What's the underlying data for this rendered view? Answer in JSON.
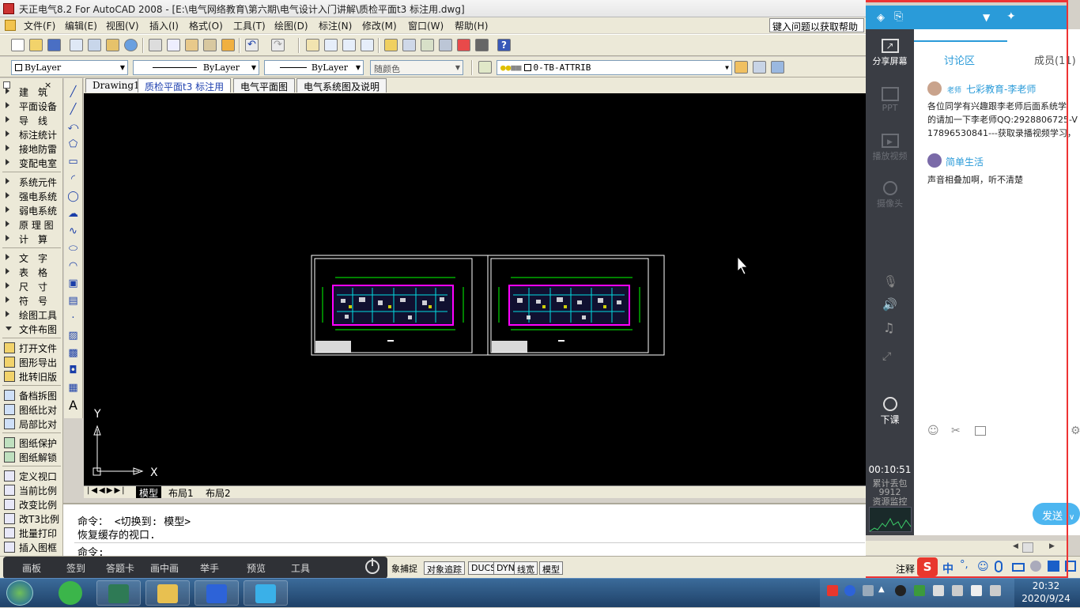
{
  "window": {
    "title": "天正电气8.2 For AutoCAD 2008 - [E:\\电气网络教育\\第六期\\电气设计入门讲解\\质检平面t3 标注用.dwg]"
  },
  "menubar": {
    "items": [
      "文件(F)",
      "编辑(E)",
      "视图(V)",
      "插入(I)",
      "格式(O)",
      "工具(T)",
      "绘图(D)",
      "标注(N)",
      "修改(M)",
      "窗口(W)",
      "帮助(H)"
    ],
    "help_placeholder": "键入问题以获取帮助"
  },
  "properties_bar": {
    "layer_combo": "ByLayer",
    "linetype_combo": "ByLayer",
    "lineweight_combo": "ByLayer",
    "color_combo": "随颜色",
    "current_layer": "0-TB-ATTRIB"
  },
  "left_panel": {
    "group1": [
      "建　筑",
      "平面设备",
      "导　线",
      "标注统计",
      "接地防雷",
      "变配电室"
    ],
    "group2": [
      "系统元件",
      "强电系统",
      "弱电系统",
      "原 理 图",
      "计　算"
    ],
    "group3": [
      "文　字",
      "表　格",
      "尺　寸",
      "符　号",
      "绘图工具",
      "文件布图"
    ],
    "group4": [
      "打开文件",
      "图形导出",
      "批转旧版"
    ],
    "group5": [
      "备档拆图",
      "图纸比对",
      "局部比对"
    ],
    "group6": [
      "图纸保护",
      "图纸解锁"
    ],
    "group7": [
      "定义视口",
      "当前比例",
      "改变比例",
      "改T3比例",
      "批量打印",
      "插入图框"
    ]
  },
  "doc_tabs": {
    "items": [
      "Drawing1",
      "质检平面t3 标注用",
      "电气平面图",
      "电气系统图及说明"
    ],
    "active_index": 1
  },
  "layout_tabs": {
    "items": [
      "模型",
      "布局1",
      "布局2"
    ],
    "active_index": 0
  },
  "canvas": {
    "axis_x": "X",
    "axis_y": "Y"
  },
  "command": {
    "line1": "命令：  <切换到: 模型>",
    "line2": "恢复缓存的视口.",
    "prompt": "命令:"
  },
  "status_bar": {
    "toggles": [
      "象捕捉",
      "对象追踪",
      "DUCS",
      "DYN",
      "线宽",
      "模型"
    ],
    "annotation_label": "注释"
  },
  "overlay_toolbar": {
    "items": [
      "画板",
      "签到",
      "答题卡",
      "画中画",
      "举手",
      "预览",
      "工具"
    ]
  },
  "side_panel": {
    "tabs": {
      "discussion": "讨论区",
      "members": "成员(11)"
    },
    "tools": [
      "分享屏幕",
      "PPT",
      "播放视频",
      "摄像头"
    ],
    "end_class": "下课",
    "timer": "00:10:51",
    "stats": [
      "累计丢包",
      "9912",
      "资源监控"
    ],
    "messages": [
      {
        "role": "老师",
        "name": "七彩教育-李老师",
        "text_lines": [
          "各位同学有兴趣跟李老师后面系统学",
          "的请加一下李老师QQ:2928806725-V",
          "17896530841---获取录播视频学习，"
        ]
      },
      {
        "role": "",
        "name": "简单生活",
        "text_lines": [
          "声音相叠加啊，听不清楚"
        ]
      }
    ],
    "send_label": "发送"
  },
  "taskbar": {
    "time": "20:32",
    "date": "2020/9/24"
  },
  "colors": {
    "accent_blue": "#2a9bd9",
    "canvas_bg": "#000000",
    "drawing_magenta": "#ff00ff",
    "drawing_green": "#00ff00"
  }
}
